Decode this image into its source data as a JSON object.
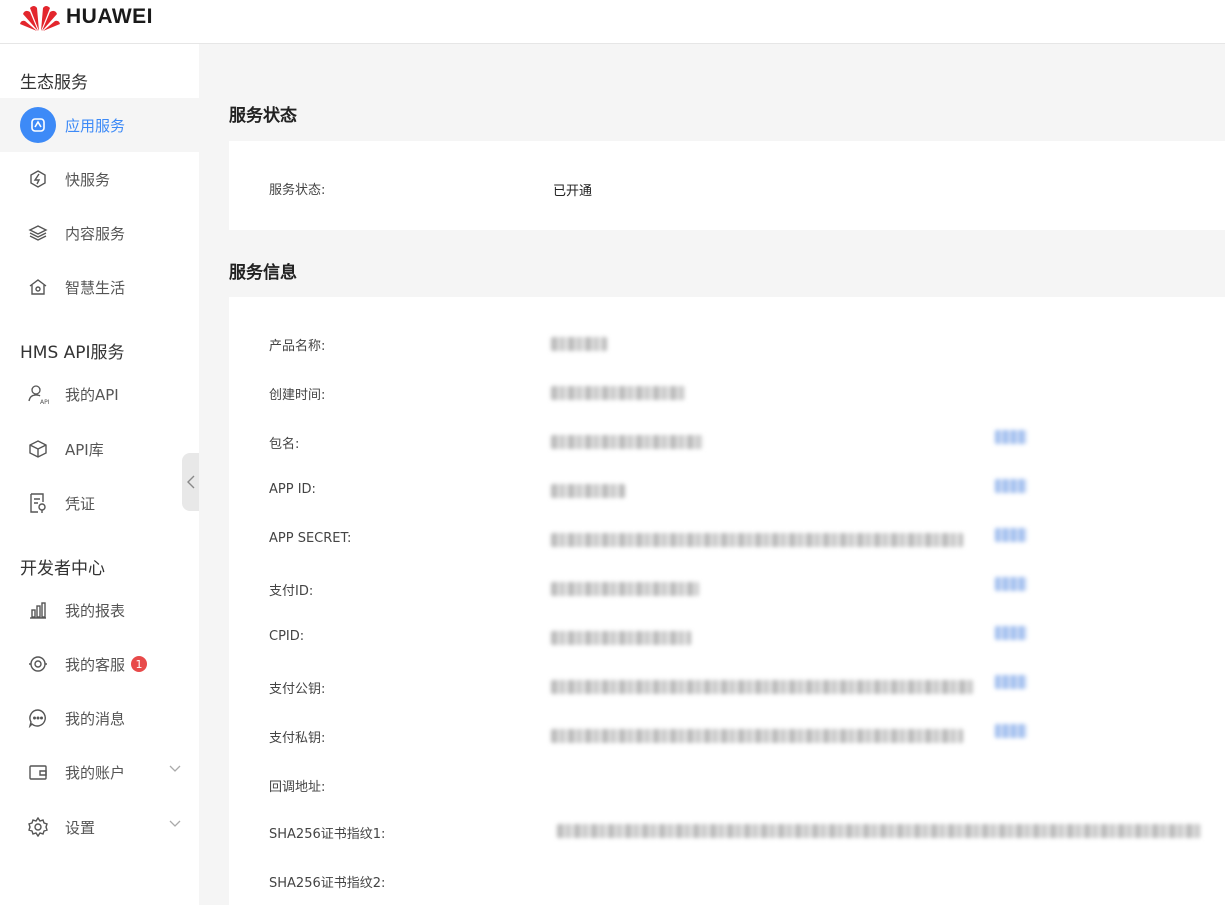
{
  "brand": {
    "name": "HUAWEI"
  },
  "sidebar": {
    "groups": [
      {
        "title": "生态服务",
        "items": [
          {
            "label": "应用服务",
            "icon": "app-service-icon",
            "active": true
          },
          {
            "label": "快服务",
            "icon": "quick-service-icon"
          },
          {
            "label": "内容服务",
            "icon": "layers-icon"
          },
          {
            "label": "智慧生活",
            "icon": "home-icon"
          }
        ]
      },
      {
        "title": "HMS API服务",
        "items": [
          {
            "label": "我的API",
            "icon": "user-api-icon"
          },
          {
            "label": "API库",
            "icon": "cube-icon"
          },
          {
            "label": "凭证",
            "icon": "credential-icon"
          }
        ]
      },
      {
        "title": "开发者中心",
        "items": [
          {
            "label": "我的报表",
            "icon": "bar-chart-icon"
          },
          {
            "label": "我的客服",
            "icon": "headset-icon",
            "badge": "1"
          },
          {
            "label": "我的消息",
            "icon": "message-icon"
          },
          {
            "label": "我的账户",
            "icon": "wallet-icon",
            "expandable": true
          },
          {
            "label": "设置",
            "icon": "gear-icon",
            "expandable": true
          }
        ]
      }
    ]
  },
  "status_section": {
    "title": "服务状态",
    "label": "服务状态:",
    "value": "已开通"
  },
  "info_section": {
    "title": "服务信息",
    "rows": [
      {
        "label": "产品名称:"
      },
      {
        "label": "创建时间:"
      },
      {
        "label": "包名:"
      },
      {
        "label": "APP ID:"
      },
      {
        "label": "APP SECRET:"
      },
      {
        "label": "支付ID:"
      },
      {
        "label": "CPID:"
      },
      {
        "label": "支付公钥:"
      },
      {
        "label": "支付私钥:"
      },
      {
        "label": "回调地址:"
      },
      {
        "label": "SHA256证书指纹1:"
      },
      {
        "label": "SHA256证书指纹2:"
      }
    ]
  },
  "colors": {
    "accent": "#3d8af7",
    "badge": "#e84a4a",
    "background": "#f5f5f5"
  }
}
